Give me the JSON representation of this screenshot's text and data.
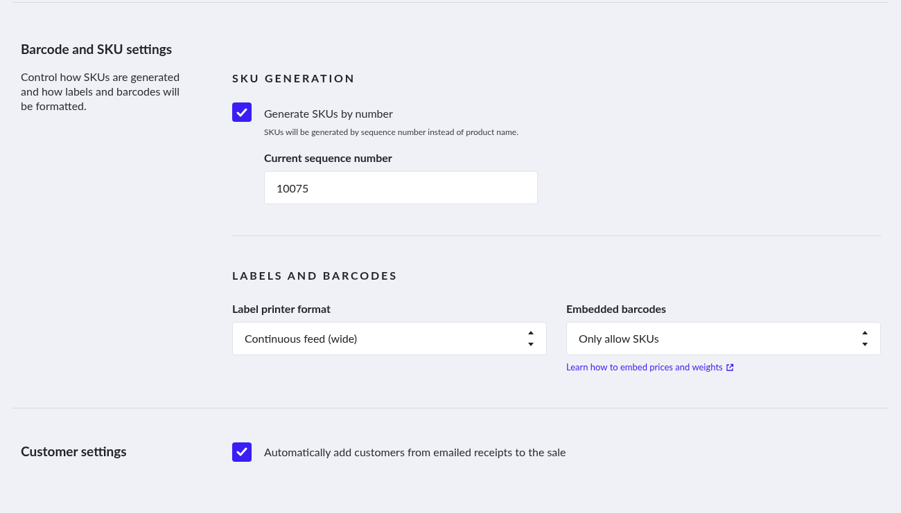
{
  "sections": [
    {
      "title": "Barcode and SKU settings",
      "description": "Control how SKUs are generated and how labels and barcodes will be formatted.",
      "groups": [
        {
          "kind": "sku",
          "heading": "SKU GENERATION",
          "checkbox": {
            "label": "Generate SKUs by number",
            "hint": "SKUs will be generated by sequence number instead of product name.",
            "checked": true
          },
          "field": {
            "label": "Current sequence number",
            "value": "10075"
          }
        },
        {
          "kind": "labels",
          "heading": "LABELS AND BARCODES",
          "selects": [
            {
              "label": "Label printer format",
              "value": "Continuous feed (wide)"
            },
            {
              "label": "Embedded barcodes",
              "value": "Only allow SKUs",
              "link": "Learn how to embed prices and weights"
            }
          ]
        }
      ]
    },
    {
      "title": "Customer settings",
      "checkbox": {
        "label": "Automatically add customers from emailed receipts to the sale",
        "checked": true
      }
    }
  ]
}
